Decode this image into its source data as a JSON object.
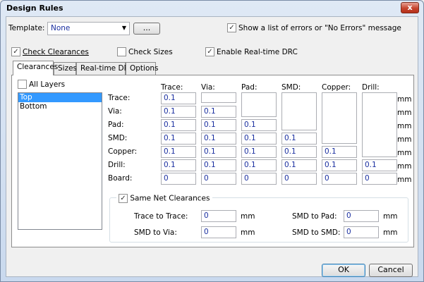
{
  "window": {
    "title": "Design Rules",
    "close_label": "x"
  },
  "template": {
    "label": "Template:",
    "value": "None",
    "browse_label": "..."
  },
  "show_errors": {
    "label": "Show a list of errors or \"No Errors\" message",
    "checked": true
  },
  "options": {
    "check_clearances": {
      "label": "Check Clearances",
      "checked": true
    },
    "check_sizes": {
      "label": "Check Sizes",
      "checked": false
    },
    "realtime_drc": {
      "label": "Enable Real-time DRC",
      "checked": true
    }
  },
  "tabs": [
    {
      "label": "Clearances",
      "active": true
    },
    {
      "label": "Sizes",
      "active": false
    },
    {
      "label": "Real-time DRC",
      "active": false
    },
    {
      "label": "Options",
      "active": false
    }
  ],
  "all_layers": {
    "label": "All Layers",
    "checked": false
  },
  "layers": [
    {
      "label": "Top",
      "selected": true
    },
    {
      "label": "Bottom",
      "selected": false
    }
  ],
  "columns": [
    "Trace:",
    "Via:",
    "Pad:",
    "SMD:",
    "Copper:",
    "Drill:"
  ],
  "rows": [
    "Trace:",
    "Via:",
    "Pad:",
    "SMD:",
    "Copper:",
    "Drill:",
    "Board:"
  ],
  "values": [
    [
      "0.1",
      "",
      "",
      "",
      "",
      ""
    ],
    [
      "0.1",
      "0.1",
      "",
      "",
      "",
      ""
    ],
    [
      "0.1",
      "0.1",
      "0.1",
      "",
      "",
      ""
    ],
    [
      "0.1",
      "0.1",
      "0.1",
      "0.1",
      "",
      ""
    ],
    [
      "0.1",
      "0.1",
      "0.1",
      "0.1",
      "0.1",
      ""
    ],
    [
      "0.1",
      "0.1",
      "0.1",
      "0.1",
      "0.1",
      "0.1"
    ],
    [
      "0",
      "0",
      "0",
      "0",
      "0",
      "0"
    ]
  ],
  "unit": "mm",
  "same_net": {
    "label": "Same Net Clearances",
    "checked": true,
    "trace_to_trace": {
      "label": "Trace to Trace:",
      "value": "0"
    },
    "smd_to_pad": {
      "label": "SMD to Pad:",
      "value": "0"
    },
    "smd_to_via": {
      "label": "SMD to Via:",
      "value": "0"
    },
    "smd_to_smd": {
      "label": "SMD to SMD:",
      "value": "0"
    }
  },
  "buttons": {
    "ok": "OK",
    "cancel": "Cancel"
  },
  "check_glyph": "✓"
}
